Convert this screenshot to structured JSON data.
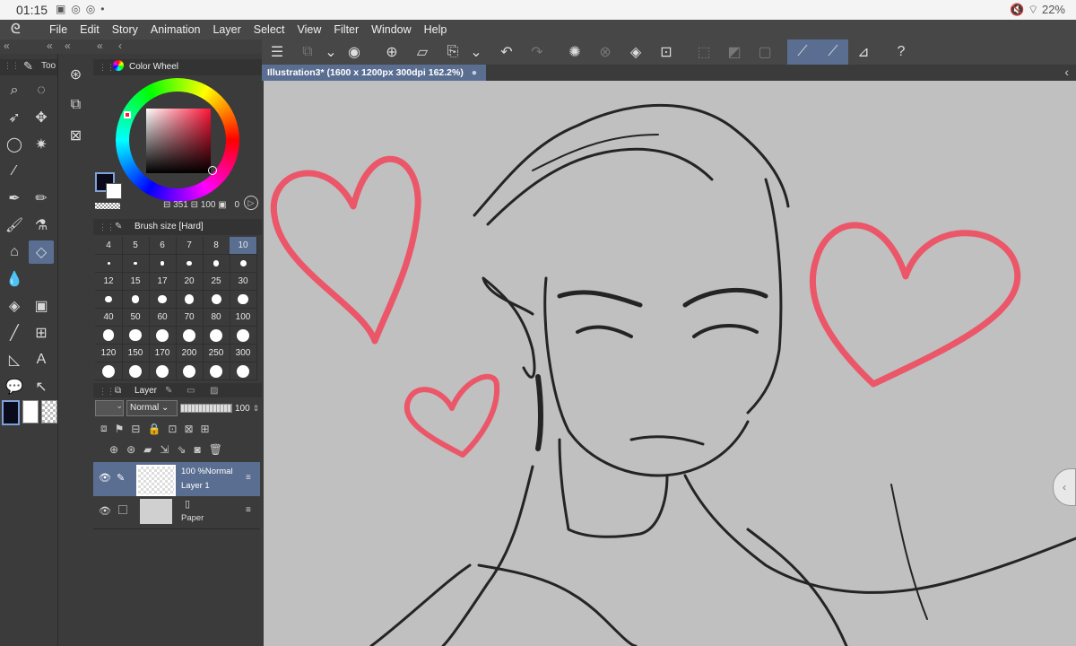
{
  "status_bar": {
    "time": "01:15",
    "battery": "22%"
  },
  "menu": [
    "File",
    "Edit",
    "Story",
    "Animation",
    "Layer",
    "Select",
    "View",
    "Filter",
    "Window",
    "Help"
  ],
  "tool_panel": {
    "title": "Too"
  },
  "color_wheel": {
    "title": "Color Wheel",
    "hue": "351",
    "saturation": "100",
    "value": "0",
    "main_color": "#0a0a1a",
    "sub_color": "#ffffff"
  },
  "brush_size": {
    "title": "Brush size [Hard]",
    "sizes": [
      "4",
      "5",
      "6",
      "7",
      "8",
      "10",
      "12",
      "15",
      "17",
      "20",
      "25",
      "30",
      "40",
      "50",
      "60",
      "70",
      "80",
      "100",
      "120",
      "150",
      "170",
      "200",
      "250",
      "300"
    ],
    "selected": "10"
  },
  "layer_panel": {
    "title": "Layer",
    "blend_mode": "Normal",
    "opacity": "100",
    "layers": [
      {
        "opacity_mode": "100 %Normal",
        "name": "Layer 1"
      },
      {
        "opacity_mode": "",
        "name": "Paper"
      }
    ]
  },
  "canvas": {
    "tab_title": "Illustration3* (1600 x 1200px 300dpi 162.2%)",
    "background": "#c0c0c0",
    "heart_color": "#ef4a5f"
  }
}
